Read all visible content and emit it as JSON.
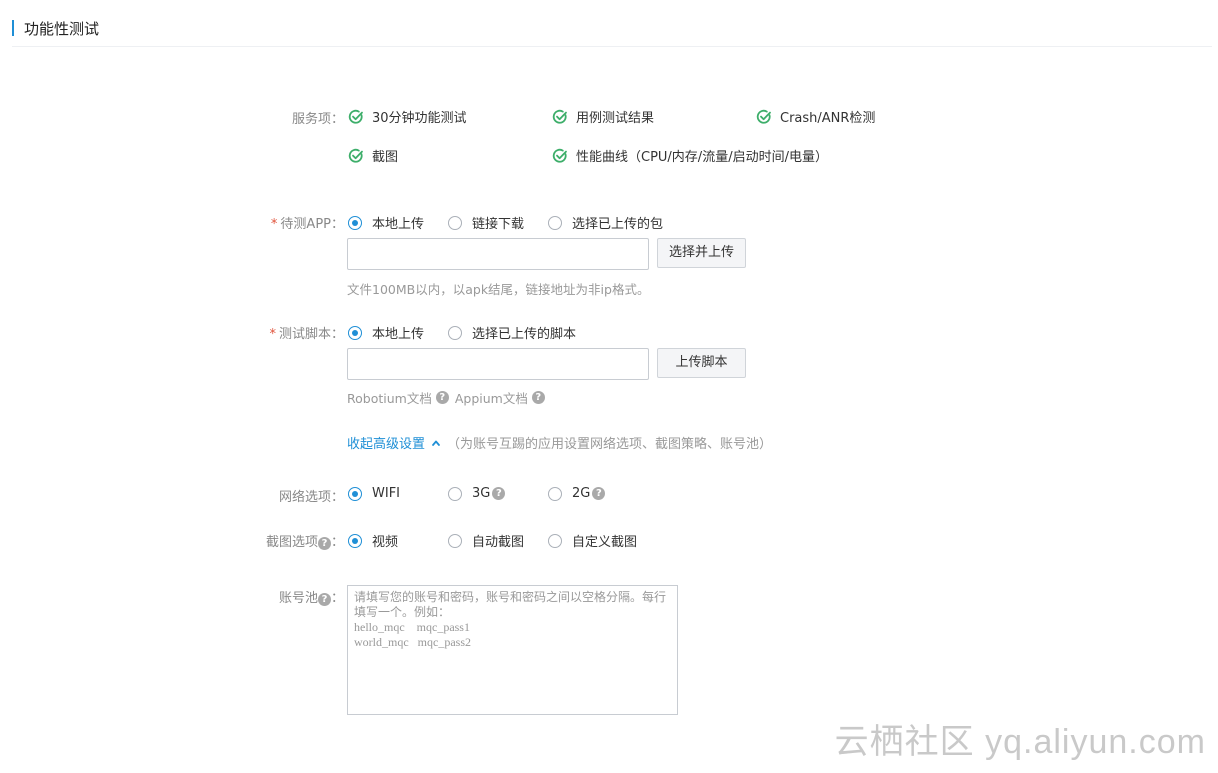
{
  "page": {
    "title": "功能性测试"
  },
  "services": {
    "label": "服务项：",
    "items": [
      "30分钟功能测试",
      "用例测试结果",
      "Crash/ANR检测",
      "截图",
      "性能曲线（CPU/内存/流量/启动时间/电量）"
    ]
  },
  "app": {
    "required_mark": "*",
    "label": "待测APP：",
    "options": [
      "本地上传",
      "链接下载",
      "选择已上传的包"
    ],
    "selected": 0,
    "input_value": "",
    "button": "选择并上传",
    "hint": "文件100MB以内，以apk结尾，链接地址为非ip格式。"
  },
  "script": {
    "required_mark": "*",
    "label": "测试脚本：",
    "options": [
      "本地上传",
      "选择已上传的脚本"
    ],
    "selected": 0,
    "input_value": "",
    "button": "上传脚本",
    "docs": [
      "Robotium文档",
      "Appium文档"
    ]
  },
  "advanced": {
    "toggle": "收起高级设置",
    "note": "（为账号互踢的应用设置网络选项、截图策略、账号池）"
  },
  "network": {
    "label": "网络选项：",
    "options": [
      "WIFI",
      "3G",
      "2G"
    ],
    "selected": 0
  },
  "screenshot": {
    "label": "截图选项",
    "colon": "：",
    "options": [
      "视频",
      "自动截图",
      "自定义截图"
    ],
    "selected": 0
  },
  "account_pool": {
    "label": "账号池",
    "colon": "：",
    "placeholder": "请填写您的账号和密码，账号和密码之间以空格分隔。每行填写一个。例如：\nhello_mqc    mqc_pass1\nworld_mqc   mqc_pass2"
  },
  "help_glyph": "?",
  "watermark": "云栖社区 yq.aliyun.com",
  "colors": {
    "accent": "#1f8fd6",
    "check": "#3dae6a",
    "required": "#e0523a"
  }
}
